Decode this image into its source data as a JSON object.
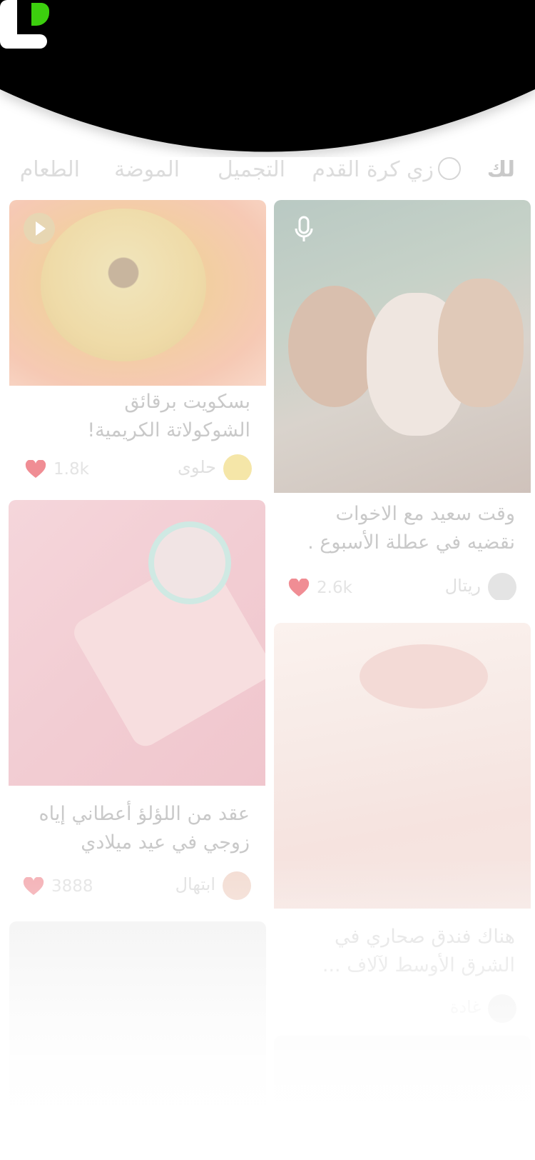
{
  "tabs": [
    {
      "label": "لك",
      "active": true
    },
    {
      "label": "زي كرة القدم",
      "icon": "soccer-ball-icon"
    },
    {
      "label": "التجميل"
    },
    {
      "label": "الموضة"
    },
    {
      "label": "الطعام"
    }
  ],
  "posts": {
    "left": [
      {
        "title": "بسكويت برقائق\nالشوكولاتة الكريمية!",
        "author": "حلوى",
        "likes": "1.8k",
        "media": "play-icon"
      },
      {
        "title": "عقد من اللؤلؤ أعطاني إياه\nزوجي في عيد ميلادي",
        "author": "ابتهال",
        "likes": "3888"
      }
    ],
    "right": [
      {
        "title": "وقت سعيد مع الاخوات\nنقضيه في عطلة الأسبوع .",
        "author": "ريتال",
        "likes": "2.6k",
        "media": "microphone-icon"
      },
      {
        "title": "هناك فندق صحاري في\nالشرق الأوسط لآلاف ...",
        "author": "غادة",
        "likes": ""
      }
    ]
  },
  "colors": {
    "header": "#000000",
    "brand_green": "#3ccf0e",
    "heart": "#f08d94"
  }
}
